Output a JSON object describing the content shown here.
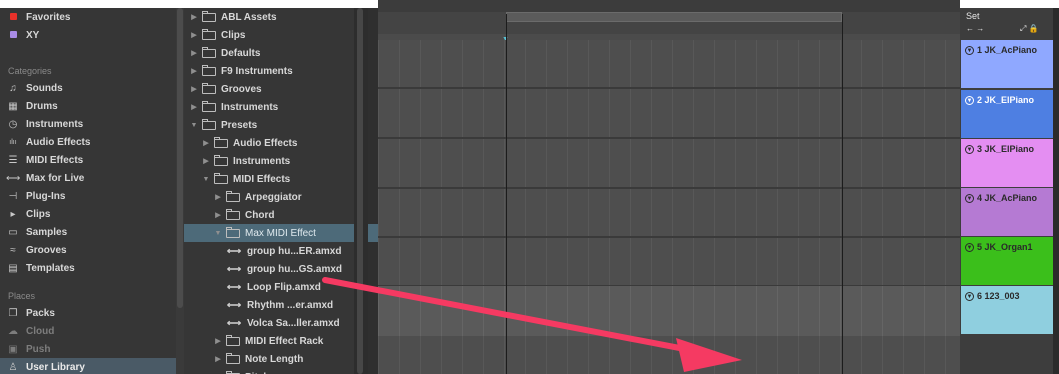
{
  "sidebar": {
    "favorites": [
      {
        "label": "Favorites",
        "color": "#e8312a"
      },
      {
        "label": "XY",
        "color": "#a98ce6"
      }
    ],
    "categories_header": "Categories",
    "categories": [
      {
        "label": "Sounds",
        "icon": "♫"
      },
      {
        "label": "Drums",
        "icon": "▦"
      },
      {
        "label": "Instruments",
        "icon": "◷"
      },
      {
        "label": "Audio Effects",
        "icon": "ılıı"
      },
      {
        "label": "MIDI Effects",
        "icon": "☰"
      },
      {
        "label": "Max for Live",
        "icon": "⟷"
      },
      {
        "label": "Plug-Ins",
        "icon": "⊣"
      },
      {
        "label": "Clips",
        "icon": "▸"
      },
      {
        "label": "Samples",
        "icon": "▭"
      },
      {
        "label": "Grooves",
        "icon": "≈"
      },
      {
        "label": "Templates",
        "icon": "▤"
      }
    ],
    "places_header": "Places",
    "places": [
      {
        "label": "Packs",
        "icon": "❐"
      },
      {
        "label": "Cloud",
        "icon": "☁"
      },
      {
        "label": "Push",
        "icon": "▣"
      },
      {
        "label": "User Library",
        "icon": "♙"
      }
    ]
  },
  "tree": {
    "items": [
      {
        "label": "ABL Assets",
        "type": "folder",
        "expanded": false
      },
      {
        "label": "Clips",
        "type": "folder",
        "expanded": false
      },
      {
        "label": "Defaults",
        "type": "folder",
        "expanded": false
      },
      {
        "label": "F9 Instruments",
        "type": "folder",
        "expanded": false
      },
      {
        "label": "Grooves",
        "type": "folder",
        "expanded": false
      },
      {
        "label": "Instruments",
        "type": "folder",
        "expanded": false
      },
      {
        "label": "Presets",
        "type": "folder",
        "expanded": true
      },
      {
        "label": "Audio Effects",
        "type": "folder",
        "expanded": false
      },
      {
        "label": "Instruments",
        "type": "folder",
        "expanded": false
      },
      {
        "label": "MIDI Effects",
        "type": "folder",
        "expanded": true
      },
      {
        "label": "Arpeggiator",
        "type": "folder",
        "expanded": false
      },
      {
        "label": "Chord",
        "type": "folder",
        "expanded": false
      },
      {
        "label": "Max MIDI Effect",
        "type": "folder",
        "expanded": true
      },
      {
        "label": "group hu...ER.amxd",
        "type": "device"
      },
      {
        "label": "group hu...GS.amxd",
        "type": "device"
      },
      {
        "label": "Loop Flip.amxd",
        "type": "device"
      },
      {
        "label": "Rhythm ...er.amxd",
        "type": "device"
      },
      {
        "label": "Volca Sa...ller.amxd",
        "type": "device"
      },
      {
        "label": "MIDI Effect Rack",
        "type": "folder",
        "expanded": false
      },
      {
        "label": "Note Length",
        "type": "folder",
        "expanded": false
      },
      {
        "label": "Pitch",
        "type": "folder",
        "expanded": false
      }
    ]
  },
  "set_panel": {
    "title": "Set",
    "nav": "← →",
    "tools": "⤢ 🔒"
  },
  "tracks": [
    {
      "label": "1 JK_AcPiano",
      "color": "#8fa8ff"
    },
    {
      "label": "2 JK_ElPiano",
      "color": "#4e7fe2"
    },
    {
      "label": "3 JK_ElPiano",
      "color": "#e48ef2"
    },
    {
      "label": "4 JK_AcPiano",
      "color": "#b57ad3"
    },
    {
      "label": "5 JK_Organ1",
      "color": "#3bbf1b"
    },
    {
      "label": "6 123_003",
      "color": "#8fcfdf"
    }
  ],
  "annotation": {
    "arrow_color": "#f53a62"
  }
}
